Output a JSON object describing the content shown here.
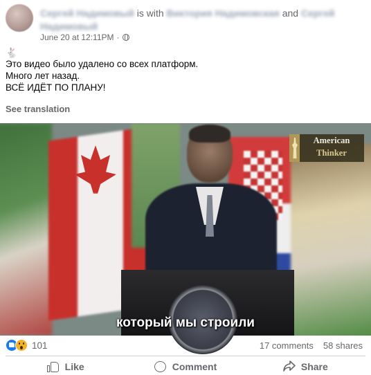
{
  "post": {
    "author_name": "Сергей Надимовый",
    "with_text": "is with",
    "tagged_1": "Виктория Надимовская",
    "and_text": "and",
    "tagged_2": "Сергей Надимовый",
    "timestamp": "June 20 at 12:11PM",
    "separator": "·",
    "privacy_icon": "globe-icon"
  },
  "content": {
    "emoji": "🐇",
    "lines": [
      "Это видео было удалено со всех платформ.",
      "Много лет назад.",
      "ВСЁ ИДЁТ ПО ПЛАНУ!"
    ],
    "see_translation": "See translation"
  },
  "video": {
    "watermark_line1": "American",
    "watermark_line2": "Thinker",
    "subtitle": "который мы строили"
  },
  "stats": {
    "reactions": [
      "like",
      "wow"
    ],
    "reaction_count": "101",
    "comments": "17 comments",
    "shares": "58 shares"
  },
  "actions": {
    "like": "Like",
    "comment": "Comment",
    "share": "Share"
  }
}
